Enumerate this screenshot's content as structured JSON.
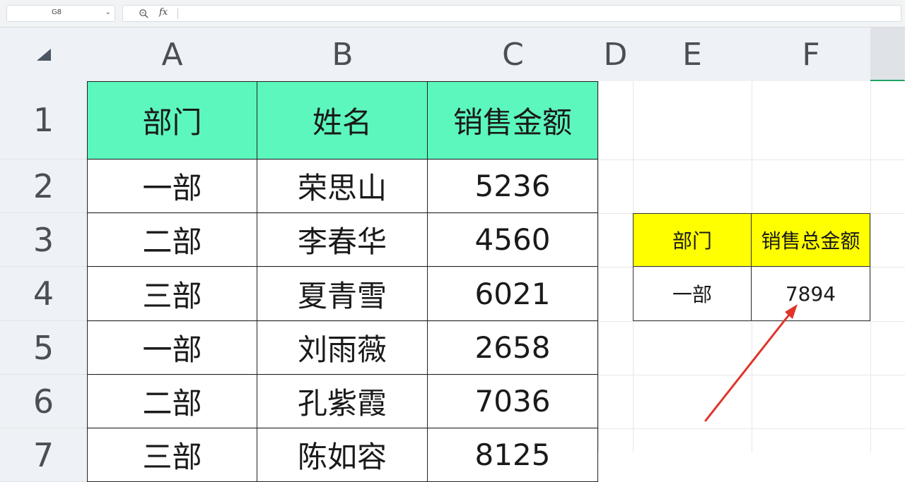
{
  "formula_bar": {
    "cell_reference": "G8",
    "fx_label": "fx",
    "formula": ""
  },
  "sheet": {
    "columns": [
      "A",
      "B",
      "C",
      "D",
      "E",
      "F"
    ],
    "rows": [
      "1",
      "2",
      "3",
      "4",
      "5",
      "6",
      "7"
    ],
    "main_table": {
      "headers": [
        "部门",
        "姓名",
        "销售金额"
      ],
      "rows": [
        [
          "一部",
          "荣思山",
          "5236"
        ],
        [
          "二部",
          "李春华",
          "4560"
        ],
        [
          "三部",
          "夏青雪",
          "6021"
        ],
        [
          "一部",
          "刘雨薇",
          "2658"
        ],
        [
          "二部",
          "孔紫霞",
          "7036"
        ],
        [
          "三部",
          "陈如容",
          "8125"
        ]
      ],
      "header_color": "#5cf7bd"
    },
    "summary_table": {
      "headers": [
        "部门",
        "销售总金额"
      ],
      "row": [
        "一部",
        "7894"
      ],
      "header_color": "#ffff00"
    },
    "annotation": {
      "arrow_color": "#e0342b",
      "arrow_target": "summary_table.row.1"
    }
  }
}
